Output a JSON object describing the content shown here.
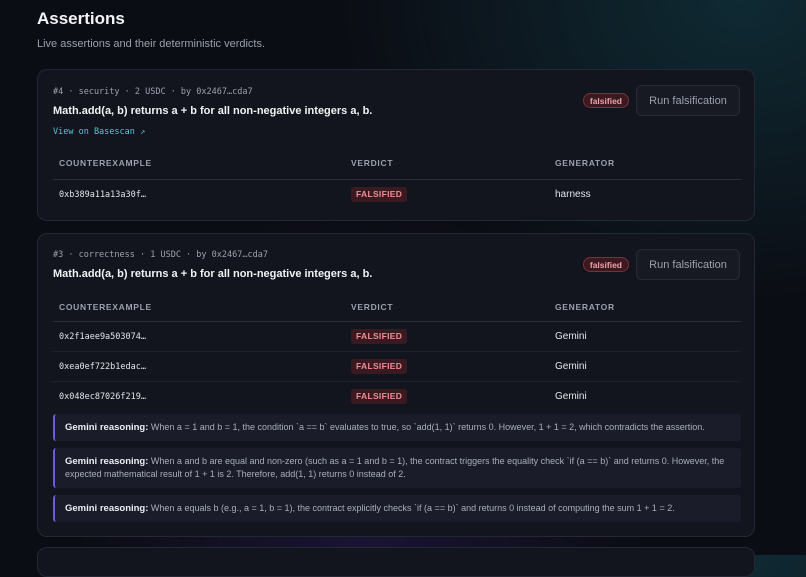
{
  "header": {
    "title": "Assertions",
    "subtitle": "Live assertions and their deterministic verdicts."
  },
  "columns": {
    "counterexample": "COUNTEREXAMPLE",
    "verdict": "VERDICT",
    "generator": "GENERATOR"
  },
  "assertions": [
    {
      "meta": "#4 · security · 2 USDC · by 0x2467…cda7",
      "claim": "Math.add(a, b) returns a + b for all non-negative integers a, b.",
      "link": "View on Basescan ↗",
      "status": "falsified",
      "action": "Run falsification",
      "rows": [
        {
          "counterexample": "0xb389a11a13a30f…",
          "verdict": "FALSIFIED",
          "generator": "harness"
        }
      ]
    },
    {
      "meta": "#3 · correctness · 1 USDC · by 0x2467…cda7",
      "claim": "Math.add(a, b) returns a + b for all non-negative integers a, b.",
      "status": "falsified",
      "action": "Run falsification",
      "rows": [
        {
          "counterexample": "0x2f1aee9a503074…",
          "verdict": "FALSIFIED",
          "generator": "Gemini"
        },
        {
          "counterexample": "0xea0ef722b1edac…",
          "verdict": "FALSIFIED",
          "generator": "Gemini"
        },
        {
          "counterexample": "0x048ec87026f219…",
          "verdict": "FALSIFIED",
          "generator": "Gemini"
        }
      ],
      "reasonings": [
        {
          "label": "Gemini reasoning:",
          "text": "When a = 1 and b = 1, the condition `a == b` evaluates to true, so `add(1, 1)` returns 0. However, 1 + 1 = 2, which contradicts the assertion."
        },
        {
          "label": "Gemini reasoning:",
          "text": "When a and b are equal and non-zero (such as a = 1 and b = 1), the contract triggers the equality check `if (a == b)` and returns 0. However, the expected mathematical result of 1 + 1 is 2. Therefore, add(1, 1) returns 0 instead of 2."
        },
        {
          "label": "Gemini reasoning:",
          "text": "When a equals b (e.g., a = 1, b = 1), the contract explicitly checks `if (a == b)` and returns 0 instead of computing the sum 1 + 1 = 2."
        }
      ]
    }
  ]
}
